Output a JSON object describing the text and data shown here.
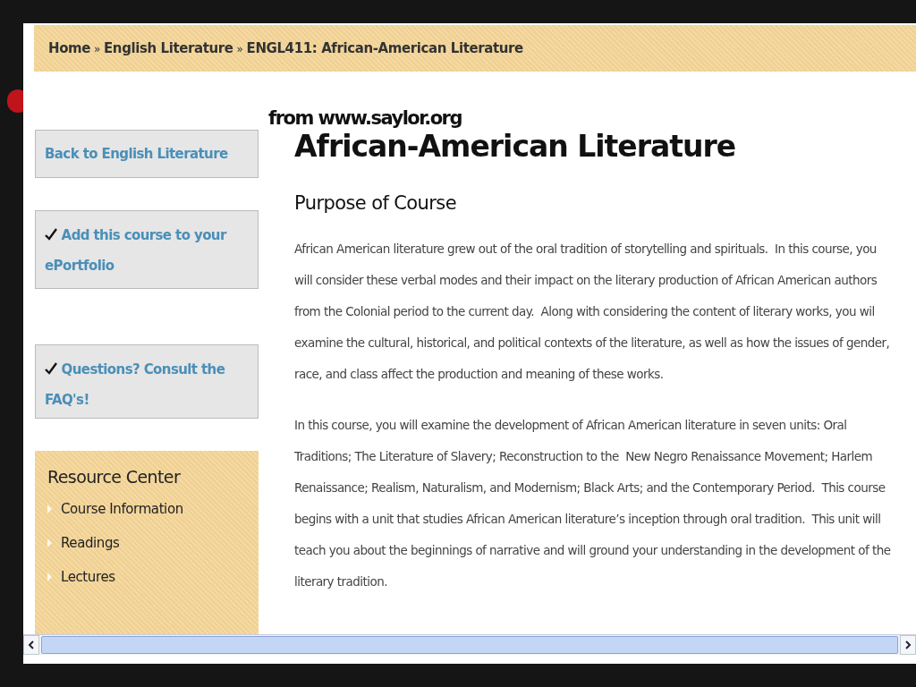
{
  "caption": "from www.saylor.org",
  "breadcrumb": [
    {
      "label": "Home"
    },
    {
      "label": "English Literature"
    },
    {
      "label": "ENGL411: African-American Literature"
    }
  ],
  "breadcrumb_separator": "»",
  "sidebar": {
    "buttons": [
      {
        "label": "Back to English Literature",
        "checked": false
      },
      {
        "label": "Add this course to your ePortfolio",
        "checked": true
      },
      {
        "label": "Questions? Consult the FAQ's!",
        "checked": true
      }
    ],
    "resource_center": {
      "title": "Resource Center",
      "items": [
        "Course Information",
        "Readings",
        "Lectures"
      ]
    }
  },
  "main": {
    "title": "African-American Literature",
    "section_title": "Purpose of Course",
    "paragraphs": [
      "African American literature grew out of the oral tradition of storytelling and spirituals.  In this course, you\nwill consider these verbal modes and their impact on the literary production of African American authors\nfrom the Colonial period to the current day.  Along with considering the content of literary works, you wil\nexamine the cultural, historical, and political contexts of the literature, as well as how the issues of gender,\nrace, and class affect the production and meaning of these works.",
      "In this course, you will examine the development of African American literature in seven units: Oral\nTraditions; The Literature of Slavery; Reconstruction to the  New Negro Renaissance Movement; Harlem\nRenaissance; Realism, Naturalism, and Modernism; Black Arts; and the Contemporary Period.  This course\nbegins with a unit that studies African American literature’s inception through oral tradition.  This unit will\nteach you about the beginnings of narrative and will ground your understanding in the development of the\nliterary tradition."
    ]
  }
}
